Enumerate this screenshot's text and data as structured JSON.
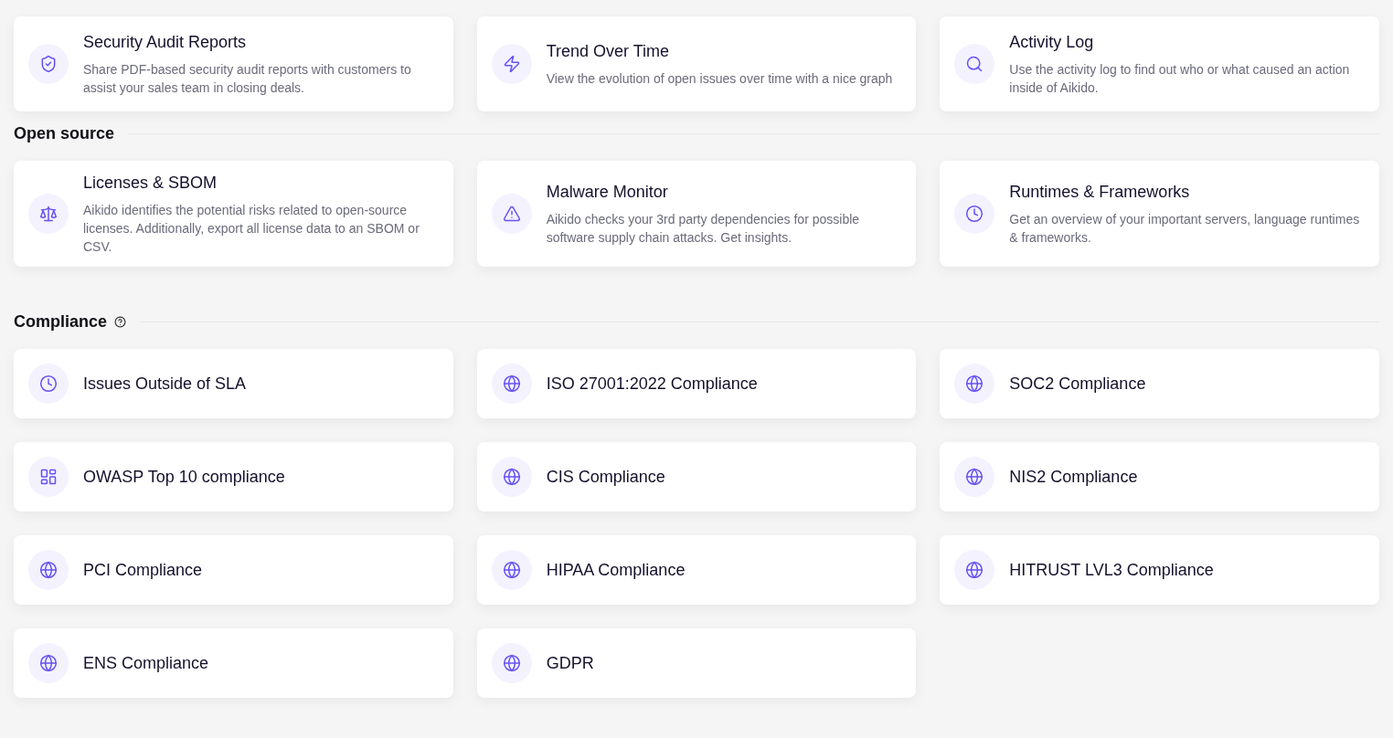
{
  "sections": [
    {
      "cards": [
        {
          "title": "Security Audit Reports",
          "description": "Share PDF-based security audit reports with customers to assist your sales team in closing deals."
        },
        {
          "title": "Trend Over Time",
          "description": "View the evolution of open issues over time with a nice graph"
        },
        {
          "title": "Activity Log",
          "description": "Use the activity log to find out who or what caused an action inside of Aikido."
        }
      ]
    },
    {
      "heading": "Open source",
      "cards": [
        {
          "title": "Licenses & SBOM",
          "description": "Aikido identifies the potential risks related to open-source licenses. Additionally, export all license data to an SBOM or CSV."
        },
        {
          "title": "Malware Monitor",
          "description": "Aikido checks your 3rd party dependencies for possible software supply chain attacks. Get insights."
        },
        {
          "title": "Runtimes & Frameworks",
          "description": "Get an overview of your important servers, language runtimes & frameworks."
        }
      ]
    },
    {
      "heading": "Compliance",
      "cards": [
        {
          "title": "Issues Outside of SLA"
        },
        {
          "title": "ISO 27001:2022 Compliance"
        },
        {
          "title": "SOC2 Compliance"
        },
        {
          "title": "OWASP Top 10 compliance"
        },
        {
          "title": "CIS Compliance"
        },
        {
          "title": "NIS2 Compliance"
        },
        {
          "title": "PCI Compliance"
        },
        {
          "title": "HIPAA Compliance"
        },
        {
          "title": "HITRUST LVL3 Compliance"
        },
        {
          "title": "ENS Compliance"
        },
        {
          "title": "GDPR"
        }
      ]
    }
  ]
}
